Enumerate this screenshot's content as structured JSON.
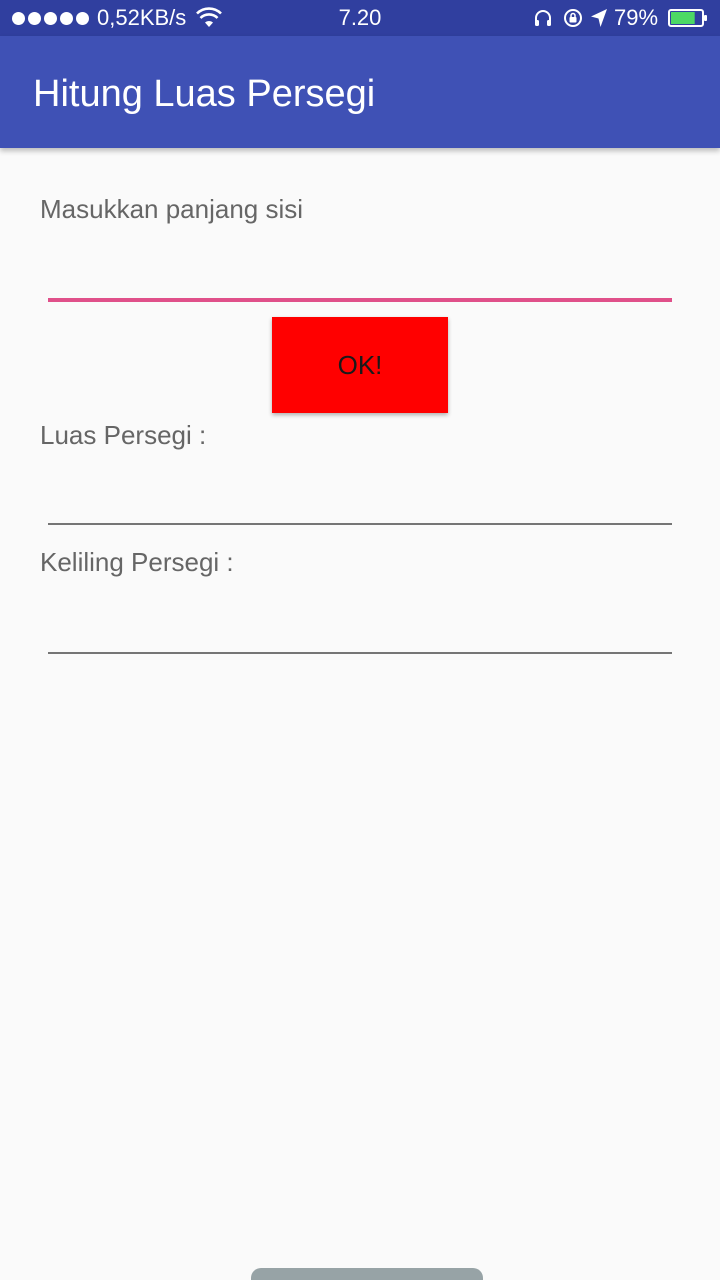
{
  "status_bar": {
    "net_speed": "0,52KB/s",
    "time": "7.20",
    "battery_percent": "79%",
    "battery_level": 0.79,
    "icons": [
      "signal-dots-icon",
      "wifi-icon",
      "headphone-icon",
      "rotation-lock-icon",
      "location-arrow-icon",
      "battery-icon"
    ]
  },
  "app_bar": {
    "title": "Hitung Luas Persegi",
    "color": "#3f51b5"
  },
  "form": {
    "side_label": "Masukkan panjang sisi",
    "side_value": "",
    "ok_label": "OK!",
    "area_label": "Luas Persegi :",
    "area_value": "",
    "perimeter_label": "Keliling Persegi :",
    "perimeter_value": ""
  },
  "colors": {
    "status_bar": "#303f9f",
    "accent": "#e0508a",
    "ok_button": "#ff0000",
    "battery_fill": "#4cd964"
  }
}
